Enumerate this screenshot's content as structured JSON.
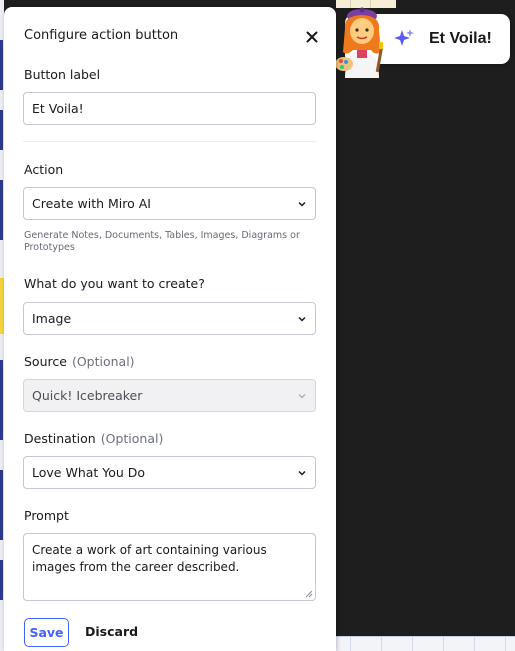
{
  "panel": {
    "title": "Configure action button",
    "close_icon": "close-icon"
  },
  "button_label": {
    "label": "Button label",
    "value": "Et Voila!"
  },
  "action": {
    "label": "Action",
    "value": "Create with Miro AI",
    "helper": "Generate Notes, Documents, Tables, Images, Diagrams or Prototypes"
  },
  "create": {
    "label": "What do you want to create?",
    "value": "Image"
  },
  "source": {
    "label": "Source",
    "optional": "(Optional)",
    "value": "Quick! Icebreaker"
  },
  "destination": {
    "label": "Destination",
    "optional": "(Optional)",
    "value": "Love What You Do"
  },
  "prompt": {
    "label": "Prompt",
    "value": "Create a work of art containing various images from the career described."
  },
  "footer": {
    "save_label": "Save",
    "discard_label": "Discard"
  },
  "canvas_button": {
    "label": "Et Voila!",
    "icon": "artist-emoji-icon",
    "sparkle_icon": "sparkle-icon"
  },
  "colors": {
    "accent": "#4262ff",
    "canvas_background": "#1e1e1e",
    "sparkle": "#5b5bf0"
  }
}
